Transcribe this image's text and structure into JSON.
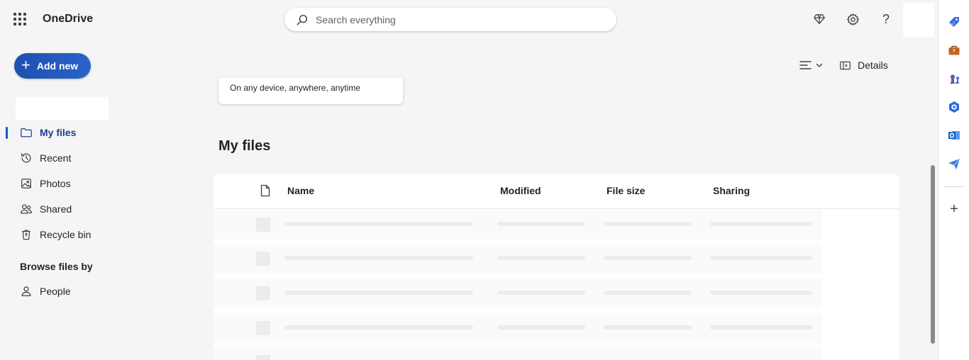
{
  "header": {
    "app_name": "OneDrive",
    "search_placeholder": "Search everything",
    "icons": [
      "app-launcher-icon",
      "premium-diamond-icon",
      "settings-gear-icon",
      "help-icon"
    ]
  },
  "sidebar": {
    "add_new_label": "Add new",
    "items": [
      {
        "label": "My files",
        "icon": "folder-icon",
        "active": true
      },
      {
        "label": "Recent",
        "icon": "history-icon",
        "active": false
      },
      {
        "label": "Photos",
        "icon": "image-icon",
        "active": false
      },
      {
        "label": "Shared",
        "icon": "people-icon",
        "active": false
      },
      {
        "label": "Recycle bin",
        "icon": "recycle-bin-icon",
        "active": false
      }
    ],
    "browse_label": "Browse files by",
    "browse_items": [
      {
        "label": "People",
        "icon": "person-icon"
      }
    ]
  },
  "main": {
    "promo_text": "On any device, anywhere, anytime",
    "details_label": "Details",
    "section_title": "My files",
    "table": {
      "columns": [
        "Name",
        "Modified",
        "File size",
        "Sharing"
      ]
    }
  },
  "right_rail": {
    "icons": [
      "tag-icon",
      "briefcase-icon",
      "chess-icon",
      "copilot-icon",
      "outlook-icon",
      "send-icon",
      "add-icon"
    ]
  },
  "colors": {
    "accent": "#1f4fb0",
    "active_nav": "#1a3f8f",
    "background": "#f5f5f5"
  }
}
